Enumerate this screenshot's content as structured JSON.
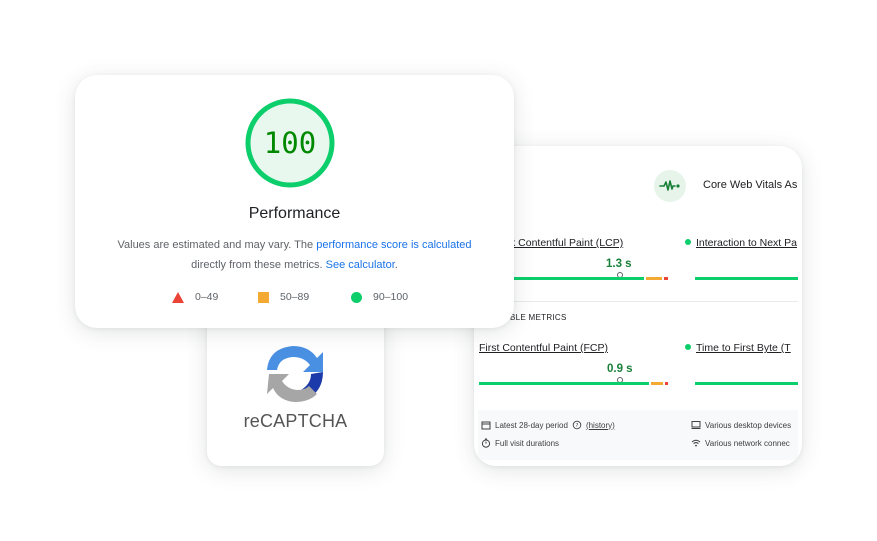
{
  "performance": {
    "score": "100",
    "title": "Performance",
    "desc_prefix": "Values are estimated and may vary. The ",
    "link_score": "performance score is calculated",
    "desc_middle": "directly from these metrics. ",
    "link_calculator": "See calculator",
    "desc_suffix": ".",
    "score_fraction": 1.0,
    "legend": [
      {
        "range": "0–49",
        "color": "#eb4335",
        "icon": "triangle-icon"
      },
      {
        "range": "50–89",
        "color": "#f4a932",
        "icon": "square-icon"
      },
      {
        "range": "90–100",
        "color": "#0cce6b",
        "icon": "circle-icon"
      }
    ]
  },
  "recaptcha": {
    "label": "reCAPTCHA",
    "icon": "recaptcha-logo-icon"
  },
  "cwv": {
    "title": "Core Web Vitals As",
    "icon": "pulse-icon",
    "section_label": "BLE METRICS",
    "metrics": [
      {
        "name": "k Contentful Paint (LCP)",
        "value": "1.3 s"
      },
      {
        "name": "Interaction to Next Pa",
        "value": ""
      },
      {
        "name": "First Contentful Paint (FCP)",
        "value": "0.9 s"
      },
      {
        "name": "Time to First Byte (T",
        "value": ""
      }
    ],
    "footer": {
      "period_prefix": "Latest 28-day period",
      "history_link": "(history)",
      "durations": "Full visit durations",
      "devices": "Various desktop devices",
      "network": "Various network connec"
    },
    "colors": {
      "good": "#0cce6b",
      "ni": "#f4a932",
      "poor": "#eb4335"
    }
  }
}
